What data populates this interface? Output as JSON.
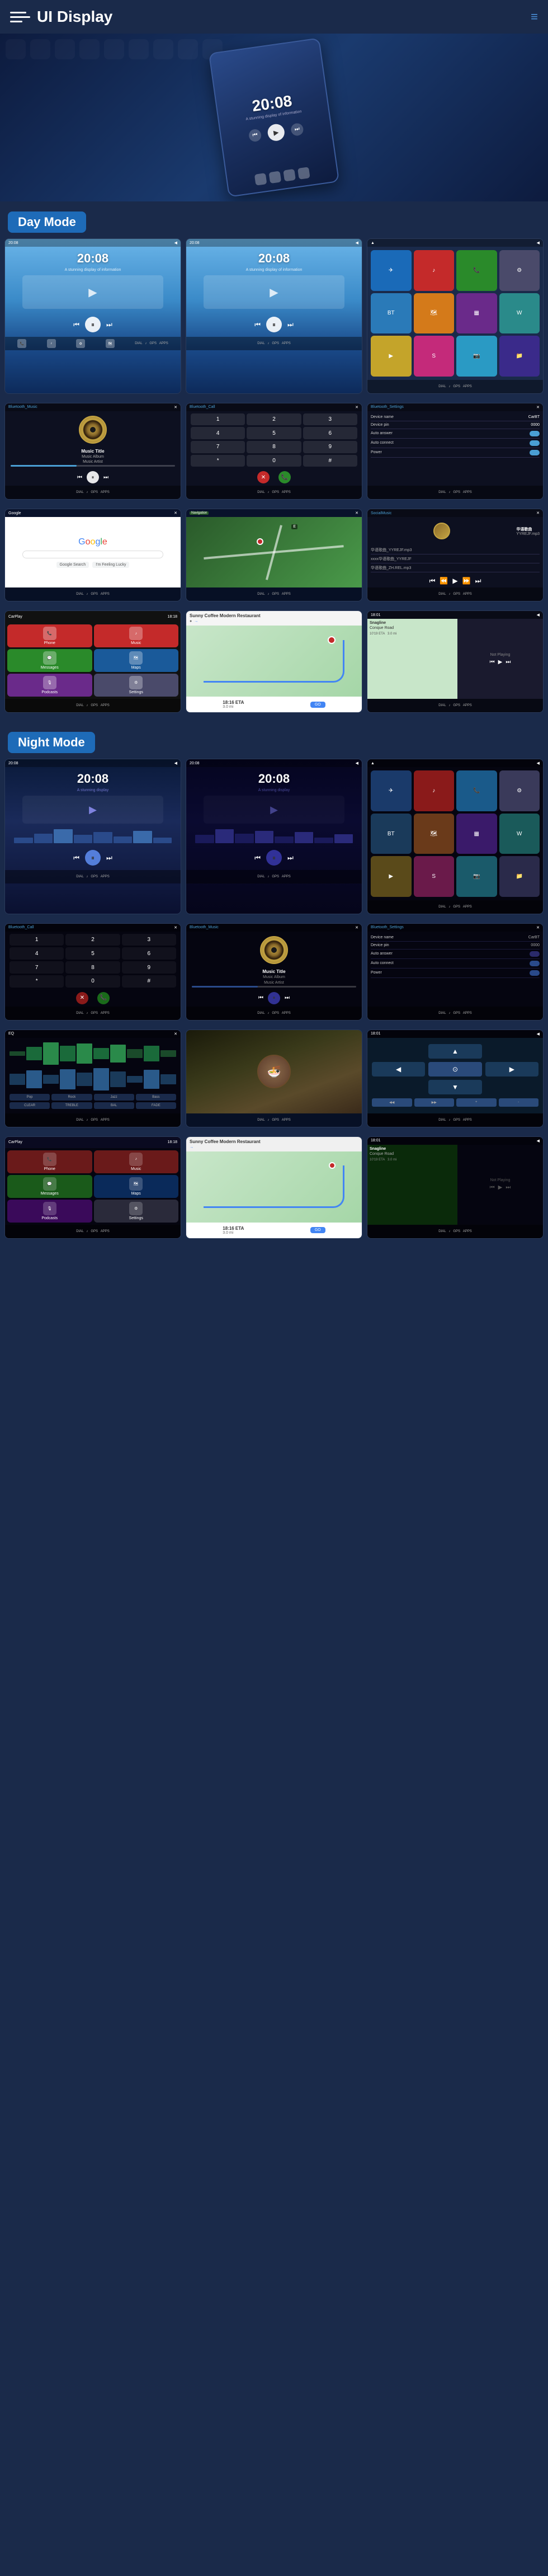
{
  "header": {
    "title": "UI Display",
    "menu_label": "menu",
    "nav_label": "navigation"
  },
  "hero": {
    "time": "20:08",
    "subtitle": "A stunning display of information"
  },
  "sections": {
    "day_mode": {
      "label": "Day Mode"
    },
    "night_mode": {
      "label": "Night Mode"
    }
  },
  "screens": {
    "day": [
      {
        "id": "day-music-1",
        "type": "music",
        "bg": "sky",
        "time": "20:08",
        "subtitle": "A stunning display of information"
      },
      {
        "id": "day-music-2",
        "type": "music",
        "bg": "sky",
        "time": "20:08",
        "subtitle": "A stunning display of information"
      },
      {
        "id": "day-apps",
        "type": "apps",
        "bg": "app-grid"
      },
      {
        "id": "day-bluetooth-music",
        "type": "bluetooth-music",
        "title": "Bluetooth_Music",
        "track": "Music Title",
        "album": "Music Album",
        "artist": "Music Artist"
      },
      {
        "id": "day-bluetooth-call",
        "type": "bluetooth-call",
        "title": "Bluetooth_Call"
      },
      {
        "id": "day-settings",
        "type": "settings",
        "title": "Bluetooth_Settings",
        "settings": [
          {
            "label": "Device name",
            "value": "CarBT"
          },
          {
            "label": "Device pin",
            "value": "0000"
          },
          {
            "label": "Auto answer",
            "value": "toggle"
          },
          {
            "label": "Auto connect",
            "value": "toggle"
          },
          {
            "label": "Power",
            "value": "toggle"
          }
        ]
      },
      {
        "id": "day-google",
        "type": "google"
      },
      {
        "id": "day-map",
        "type": "map"
      },
      {
        "id": "day-social",
        "type": "social-music",
        "title": "SocialMusic",
        "tracks": [
          "华语歌曲_YYREJF.mp3",
          "xxxx华语歌曲_YYREJF",
          "华语歌曲_ZH.REL.mp3"
        ]
      },
      {
        "id": "day-carplay-1",
        "type": "carplay"
      },
      {
        "id": "day-nav-1",
        "type": "navigation",
        "restaurant": "Sunny Coffee Modern Restaurant",
        "eta": "18:16 ETA",
        "distance": "3.0 mi",
        "go_label": "GO"
      },
      {
        "id": "day-not-playing",
        "type": "not-playing",
        "label": "Not Playing",
        "road": "Snagline / Conque Road",
        "distance": "10'19 ETA  3.0 mi"
      }
    ],
    "night": [
      {
        "id": "night-music-1",
        "type": "music-night",
        "bg": "night-deep",
        "time": "20:08"
      },
      {
        "id": "night-music-2",
        "type": "music-night",
        "bg": "night-space",
        "time": "20:08"
      },
      {
        "id": "night-apps",
        "type": "apps-night"
      },
      {
        "id": "night-call",
        "type": "bluetooth-call-night",
        "title": "Bluetooth_Call"
      },
      {
        "id": "night-bt-music",
        "type": "bluetooth-music-night",
        "title": "Bluetooth_Music",
        "track": "Music Title",
        "album": "Music Album",
        "artist": "Music Artist"
      },
      {
        "id": "night-settings",
        "type": "settings-night",
        "title": "Bluetooth_Settings"
      },
      {
        "id": "night-equalizer",
        "type": "equalizer"
      },
      {
        "id": "night-food",
        "type": "food-photo"
      },
      {
        "id": "night-map-dark",
        "type": "map-dark"
      },
      {
        "id": "night-carplay",
        "type": "carplay-night"
      },
      {
        "id": "night-nav",
        "type": "navigation-night",
        "restaurant": "Sunny Coffee Modern Restaurant",
        "go_label": "GO"
      },
      {
        "id": "night-not-playing",
        "type": "not-playing-night",
        "road": "Snagline / Conque Road"
      }
    ]
  },
  "music": {
    "track_title": "Music Title",
    "album": "Music Album",
    "artist": "Music Artist"
  },
  "nav": {
    "restaurant": "Sunny Coffee Modern Restaurant",
    "eta_label": "18:16 ETA",
    "distance": "3.0 mi",
    "road": "Start on Snagline / Conque Road",
    "go": "GO"
  }
}
